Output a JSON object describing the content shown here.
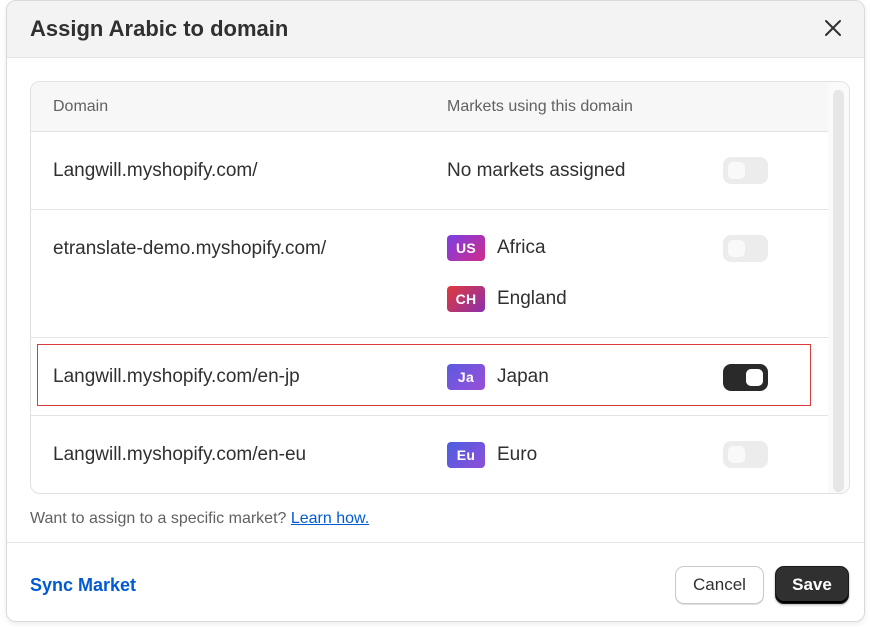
{
  "modal": {
    "title": "Assign Arabic to domain",
    "close_icon": "close-icon"
  },
  "table": {
    "headers": {
      "domain": "Domain",
      "markets": "Markets using this domain"
    },
    "rows": [
      {
        "domain": "Langwill.myshopify.com/",
        "no_markets_text": "No markets assigned",
        "markets": [],
        "assigned": false
      },
      {
        "domain": "etranslate-demo.myshopify.com/",
        "markets": [
          {
            "code": "US",
            "name": "Africa",
            "color_from": "#7b3fe4",
            "color_to": "#d12c8a"
          },
          {
            "code": "CH",
            "name": "England",
            "color_from": "#e03a3a",
            "color_to": "#8a2fb0"
          }
        ],
        "assigned": false
      },
      {
        "domain": "Langwill.myshopify.com/en-jp",
        "markets": [
          {
            "code": "Ja",
            "name": "Japan",
            "color_from": "#5b5be0",
            "color_to": "#9b4fd8"
          }
        ],
        "assigned": true,
        "highlighted": true
      },
      {
        "domain": "Langwill.myshopify.com/en-eu",
        "markets": [
          {
            "code": "Eu",
            "name": "Euro",
            "color_from": "#4a5fe0",
            "color_to": "#8f4fd8"
          }
        ],
        "assigned": false
      }
    ]
  },
  "help": {
    "text": "Want to assign to a specific market?",
    "link": "Learn how."
  },
  "footer": {
    "sync_label": "Sync Market",
    "cancel_label": "Cancel",
    "save_label": "Save"
  },
  "colors": {
    "link": "#005bd3",
    "toggle_on": "#2a2a2a",
    "highlight_border": "#d93a3a"
  }
}
